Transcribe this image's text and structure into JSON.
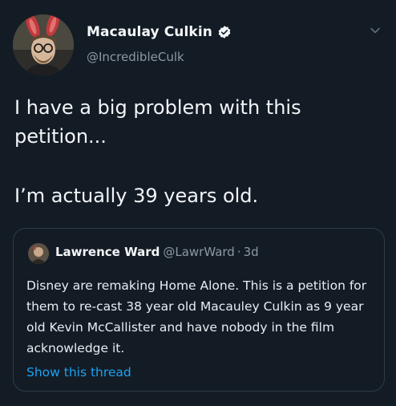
{
  "tweet": {
    "author": {
      "display_name": "Macaulay Culkin",
      "handle": "@IncredibleCulk",
      "verified": true,
      "avatar_icon": "avatar-photo-bunny-ears"
    },
    "text_line_1": "I have a big problem with this\npetition...",
    "text_line_2": "I’m actually 39 years old.",
    "menu_icon": "chevron-down-icon"
  },
  "quoted_tweet": {
    "author": {
      "display_name": "Lawrence Ward",
      "handle": "@LawrWard",
      "time": "3d"
    },
    "separator": "·",
    "body": "Disney are remaking Home Alone. This is a petition for them to re-cast 38 year old Macauley Culkin as 9 year old Kevin McCallister and have nobody in the film acknowledge it.",
    "show_thread_label": "Show this thread"
  },
  "colors": {
    "background": "#131c25",
    "link": "#1da1f2",
    "secondary_text": "#8b98a5",
    "border": "#2f3b48"
  }
}
